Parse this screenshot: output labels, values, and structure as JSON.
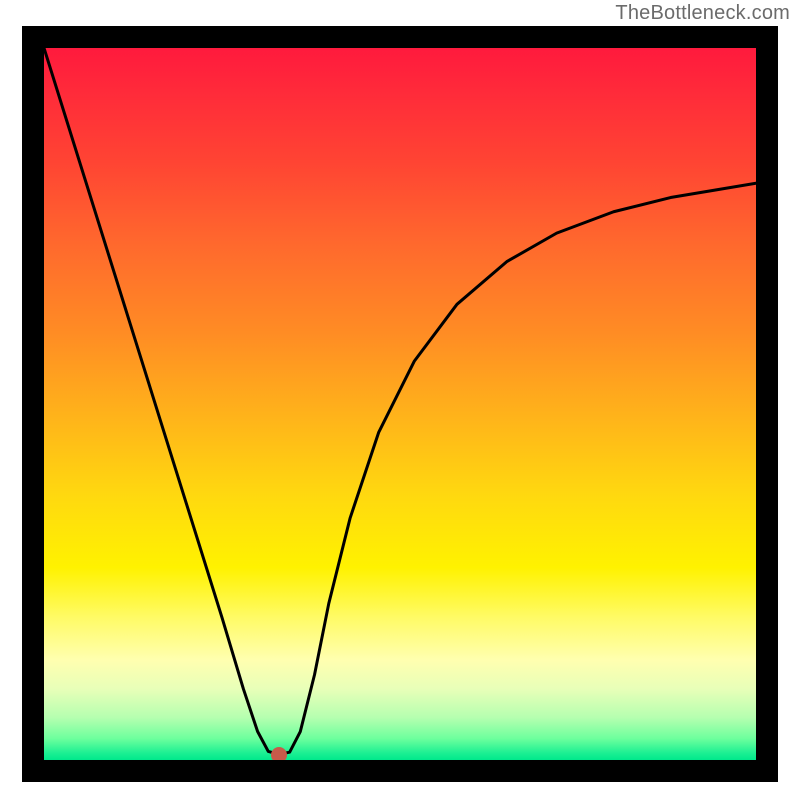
{
  "attribution": "TheBottleneck.com",
  "chart_data": {
    "type": "line",
    "title": "",
    "xlabel": "",
    "ylabel": "",
    "xlim": [
      0,
      1
    ],
    "ylim": [
      0,
      1
    ],
    "series": [
      {
        "name": "bottleneck-curve",
        "x": [
          0.0,
          0.05,
          0.1,
          0.15,
          0.2,
          0.25,
          0.28,
          0.3,
          0.315,
          0.33,
          0.345,
          0.36,
          0.38,
          0.4,
          0.43,
          0.47,
          0.52,
          0.58,
          0.65,
          0.72,
          0.8,
          0.88,
          0.94,
          1.0
        ],
        "values": [
          1.0,
          0.84,
          0.68,
          0.52,
          0.36,
          0.2,
          0.1,
          0.04,
          0.012,
          0.008,
          0.011,
          0.04,
          0.12,
          0.22,
          0.34,
          0.46,
          0.56,
          0.64,
          0.7,
          0.74,
          0.77,
          0.79,
          0.8,
          0.81
        ]
      }
    ],
    "minimum_marker": {
      "x": 0.33,
      "y": 0.007
    },
    "gradient_colors": {
      "top": "#ff1a3d",
      "mid": "#ffe000",
      "bottom": "#00e88c"
    },
    "frame_color": "#000000"
  }
}
